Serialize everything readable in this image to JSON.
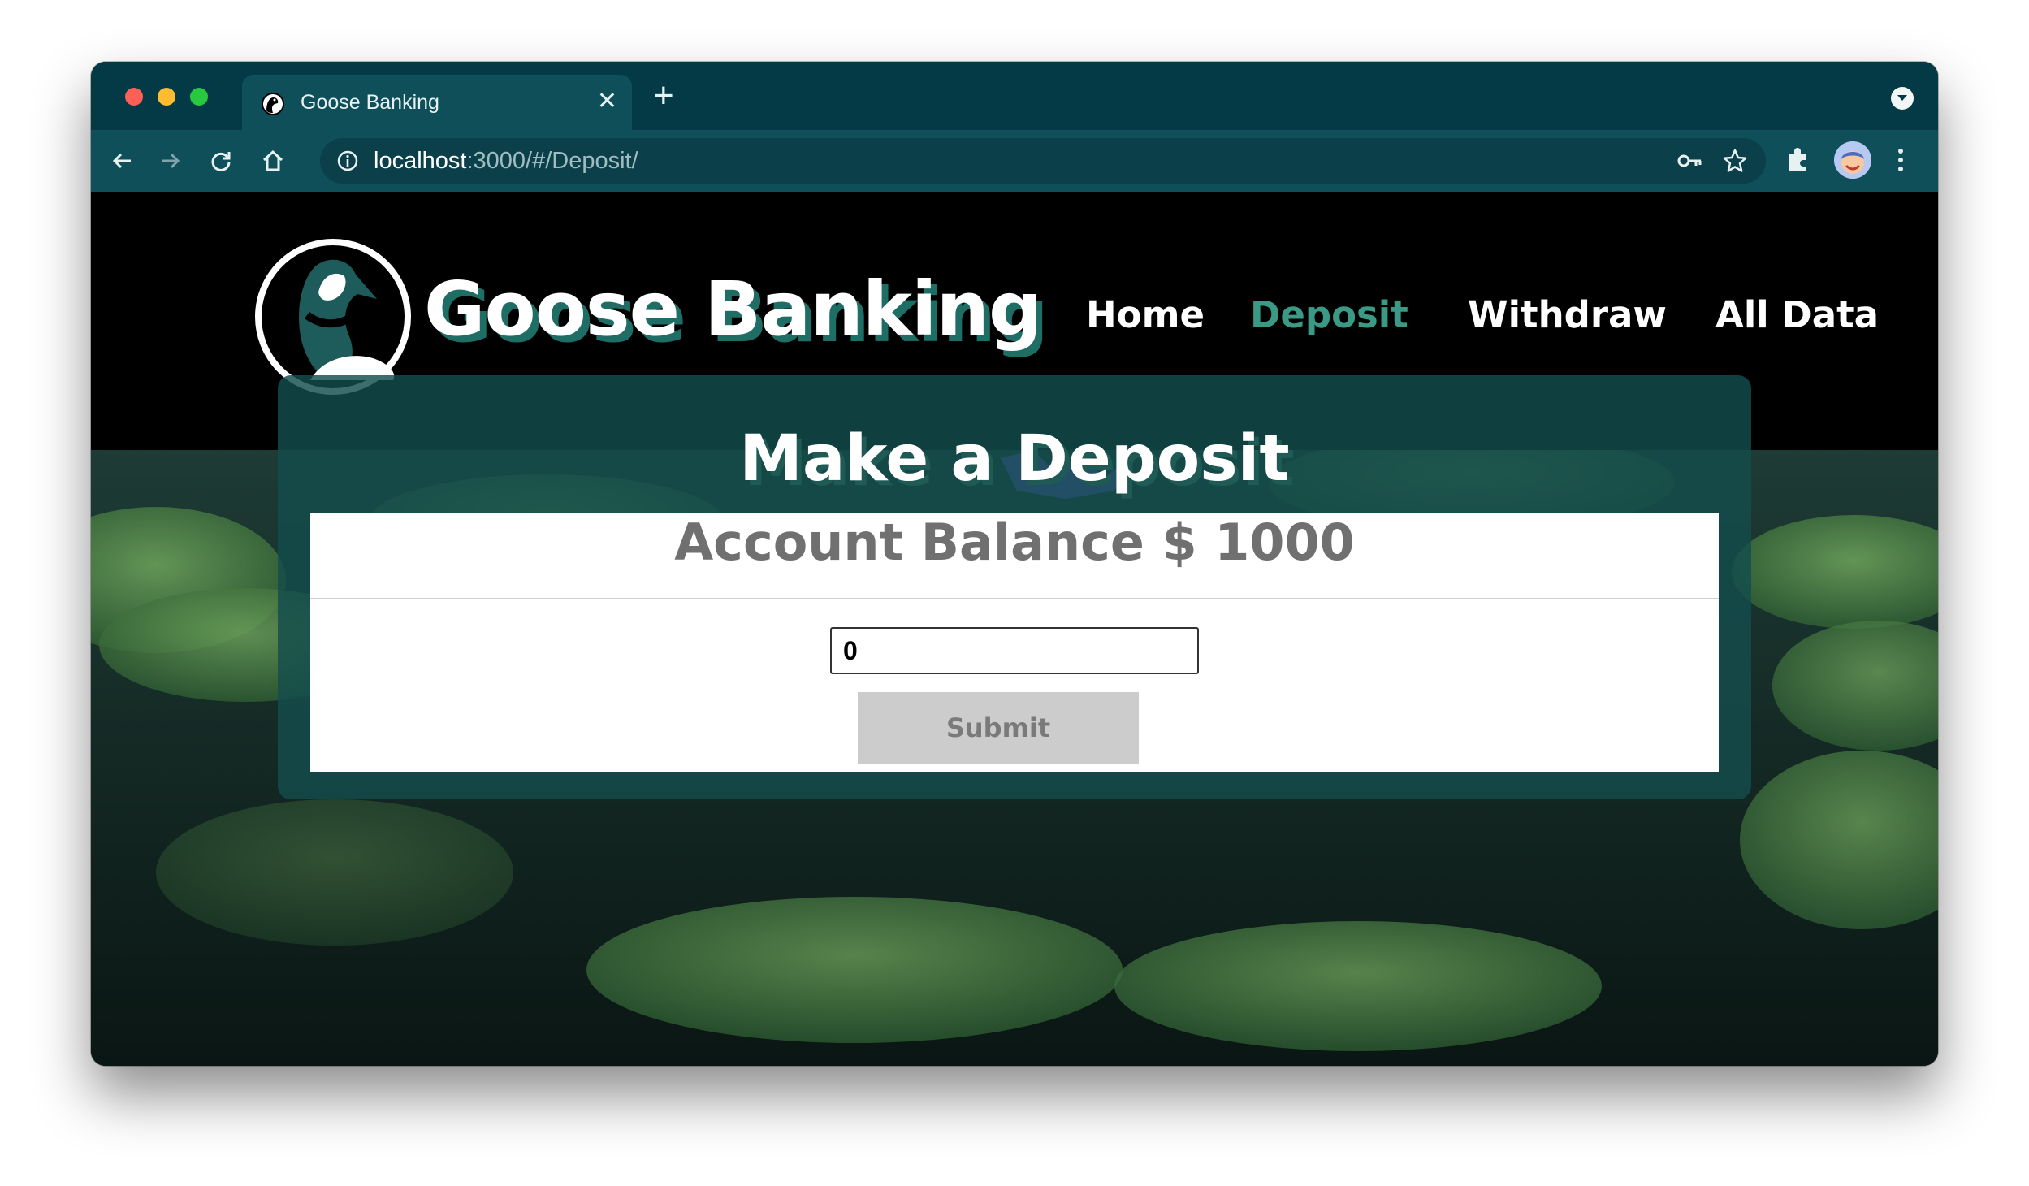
{
  "browser": {
    "tab_title": "Goose Banking",
    "tab_close": "✕",
    "new_tab": "+",
    "url_host": "localhost",
    "url_path": ":3000/#/Deposit/"
  },
  "navbar": {
    "brand": "Goose Banking",
    "links": [
      {
        "label": "Home",
        "active": false
      },
      {
        "label": "Deposit",
        "active": true
      },
      {
        "label": "Withdraw",
        "active": false
      },
      {
        "label": "All Data",
        "active": false
      }
    ]
  },
  "card": {
    "title": "Make a Deposit",
    "balance_text": "Account Balance $ 1000",
    "amount_value": "0",
    "submit_label": "Submit"
  },
  "colors": {
    "chrome_frame": "#033a45",
    "chrome_toolbar": "#0e4f5a",
    "nav_active": "#3a9a85",
    "card_bg": "#134d4d",
    "submit_bg": "#cccccc"
  },
  "icons": [
    "goose-favicon-icon",
    "back-arrow-icon",
    "forward-arrow-icon",
    "reload-icon",
    "home-icon",
    "info-icon",
    "key-icon",
    "star-icon",
    "puzzle-icon",
    "kebab-menu-icon",
    "goose-logo-icon"
  ]
}
